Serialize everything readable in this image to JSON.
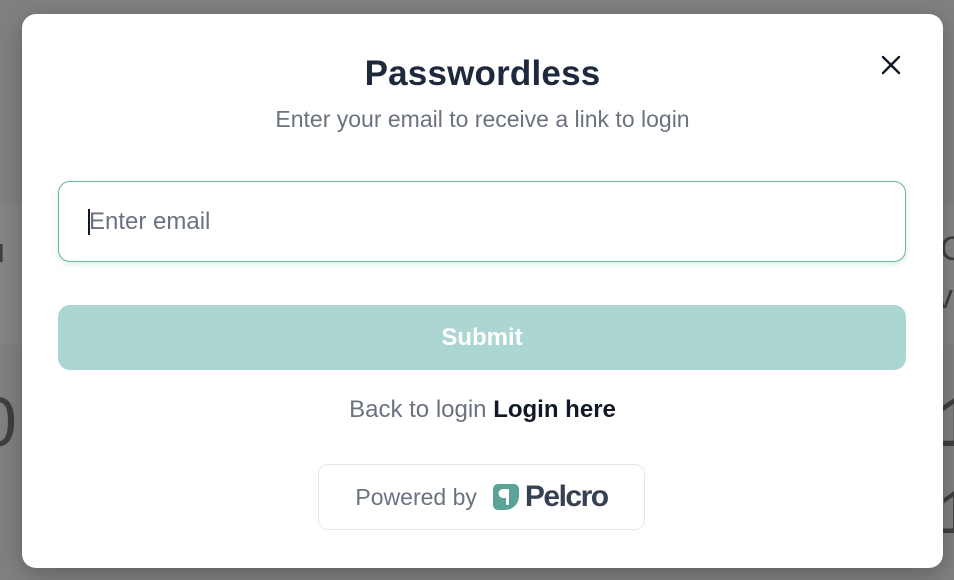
{
  "modal": {
    "title": "Passwordless",
    "subtitle": "Enter your email to receive a link to login",
    "close_icon": "close-icon"
  },
  "form": {
    "email_placeholder": "Enter email",
    "email_value": "",
    "submit_label": "Submit"
  },
  "footer": {
    "back_text": "Back to login",
    "login_link": "Login here",
    "powered_by": "Powered by",
    "brand_name": "Pelcro",
    "brand_icon": "pelcro-logo-icon"
  },
  "colors": {
    "accent": "#6bb4a8",
    "submit_bg": "#acd6d2",
    "brand_green": "#5aa396",
    "title": "#1e293b",
    "muted": "#6b7280"
  }
}
